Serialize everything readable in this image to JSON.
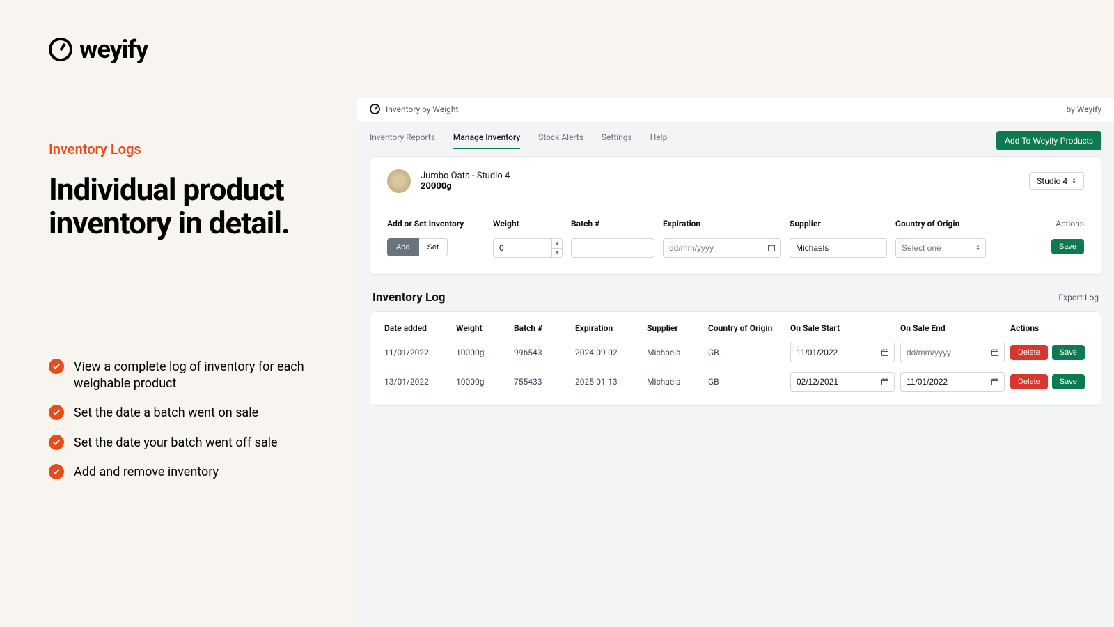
{
  "brand": {
    "name": "weyify"
  },
  "marketing": {
    "eyebrow": "Inventory Logs",
    "headline": "Individual product inventory in detail.",
    "bullets": [
      "View a complete log of inventory for each weighable product",
      "Set the date a batch went on sale",
      "Set the date your batch went off sale",
      "Add and remove inventory"
    ]
  },
  "app": {
    "header_title": "Inventory by Weight",
    "byline": "by Weyify",
    "tabs": [
      "Inventory Reports",
      "Manage Inventory",
      "Stock Alerts",
      "Settings",
      "Help"
    ],
    "active_tab_index": 1,
    "primary_cta": "Add To Weyify Products"
  },
  "product": {
    "name": "Jumbo Oats - Studio 4",
    "quantity": "20000g",
    "location_selector": "Studio 4"
  },
  "add_form": {
    "cols": {
      "addset": "Add or Set Inventory",
      "weight": "Weight",
      "batch": "Batch #",
      "expiration": "Expiration",
      "supplier": "Supplier",
      "country": "Country of Origin",
      "actions": "Actions"
    },
    "toggle": {
      "add": "Add",
      "set": "Set",
      "active": "add"
    },
    "weight_value": "0",
    "batch_value": "",
    "expiration_placeholder": "dd/mm/yyyy",
    "supplier_value": "Michaels",
    "country_placeholder": "Select one",
    "save_label": "Save"
  },
  "log": {
    "title": "Inventory Log",
    "export_label": "Export Log",
    "cols": {
      "date": "Date added",
      "weight": "Weight",
      "batch": "Batch #",
      "expiration": "Expiration",
      "supplier": "Supplier",
      "country": "Country of Origin",
      "start": "On Sale Start",
      "end": "On Sale End",
      "actions": "Actions"
    },
    "end_placeholder": "dd/mm/yyyy",
    "delete_label": "Delete",
    "save_label": "Save",
    "rows": [
      {
        "date": "11/01/2022",
        "weight": "10000g",
        "batch": "996543",
        "expiration": "2024-09-02",
        "supplier": "Michaels",
        "country": "GB",
        "start": "11/01/2022",
        "end": ""
      },
      {
        "date": "13/01/2022",
        "weight": "10000g",
        "batch": "755433",
        "expiration": "2025-01-13",
        "supplier": "Michaels",
        "country": "GB",
        "start": "02/12/2021",
        "end": "11/01/2022"
      }
    ]
  }
}
